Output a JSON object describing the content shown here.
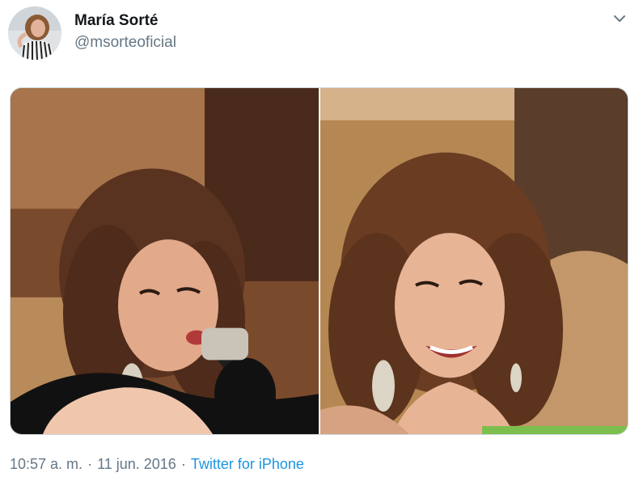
{
  "tweet": {
    "author": {
      "name": "María Sorté",
      "handle": "@msorteoficial"
    },
    "media": [
      {
        "content": "singing-with-microphone"
      },
      {
        "content": "smiling"
      }
    ],
    "footer": {
      "time": "10:57 a. m.",
      "separator": "·",
      "date": "11 jun. 2016",
      "source": "Twitter for iPhone"
    },
    "icons": {
      "menu": "chevron-down-icon"
    },
    "colors": {
      "text": "#14171a",
      "secondary": "#657786",
      "link": "#1b95e0",
      "border": "#ccd6dd"
    }
  }
}
